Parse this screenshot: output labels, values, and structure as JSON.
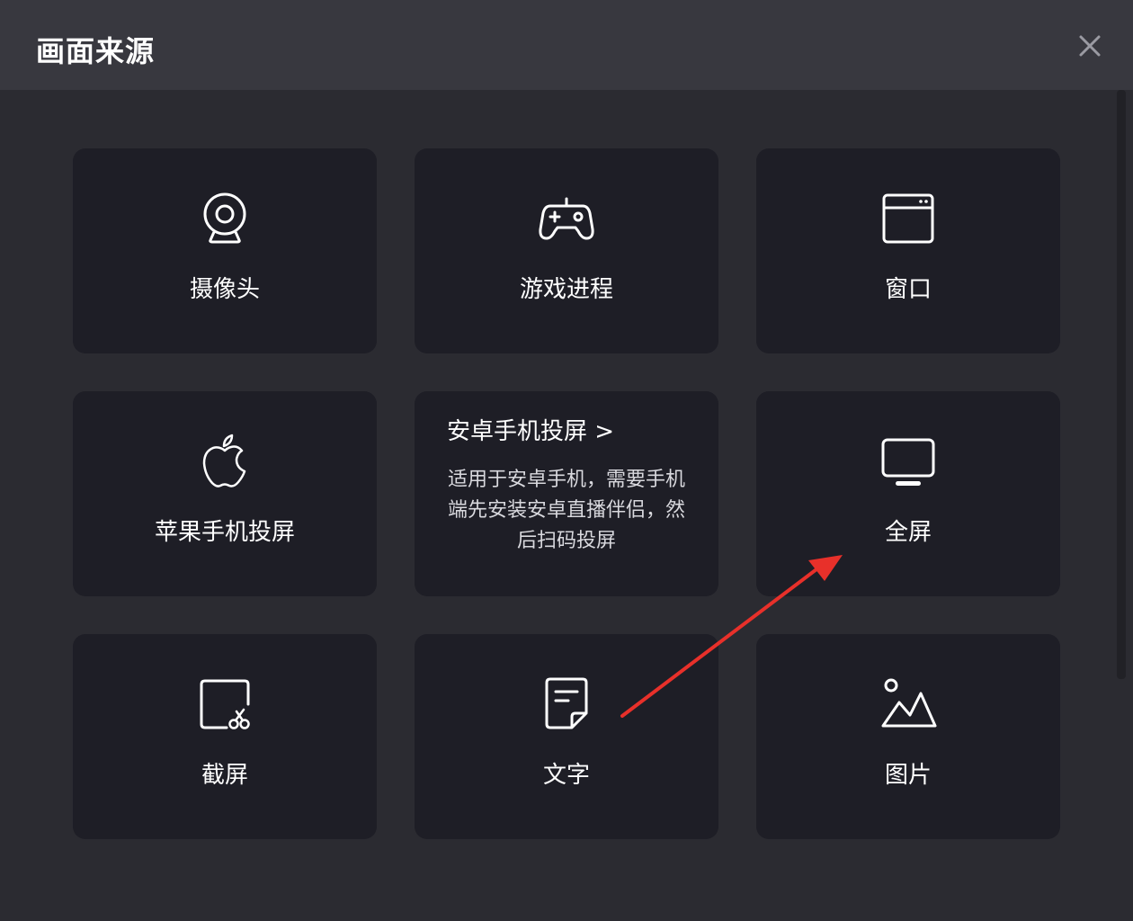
{
  "dialog": {
    "title": "画面来源"
  },
  "icons": {
    "close": "close-icon",
    "webcam": "webcam-icon",
    "gamepad": "gamepad-icon",
    "window": "window-icon",
    "apple": "apple-icon",
    "monitor": "monitor-icon",
    "screenshot": "screenshot-icon",
    "text": "text-note-icon",
    "image": "image-icon"
  },
  "sources": {
    "camera": "摄像头",
    "game": "游戏进程",
    "window": "窗口",
    "iphone": "苹果手机投屏",
    "android_title": "安卓手机投屏 >",
    "android_desc": "适用于安卓手机，需要手机端先安装安卓直播伴侣，然后扫码投屏",
    "fullscreen": "全屏",
    "screenshot": "截屏",
    "text": "文字",
    "image": "图片"
  },
  "colors": {
    "header_bg": "#38383f",
    "body_bg": "#2b2b31",
    "card_bg": "#1e1e26",
    "text": "#ffffff",
    "annotation_arrow": "#e8302a"
  }
}
